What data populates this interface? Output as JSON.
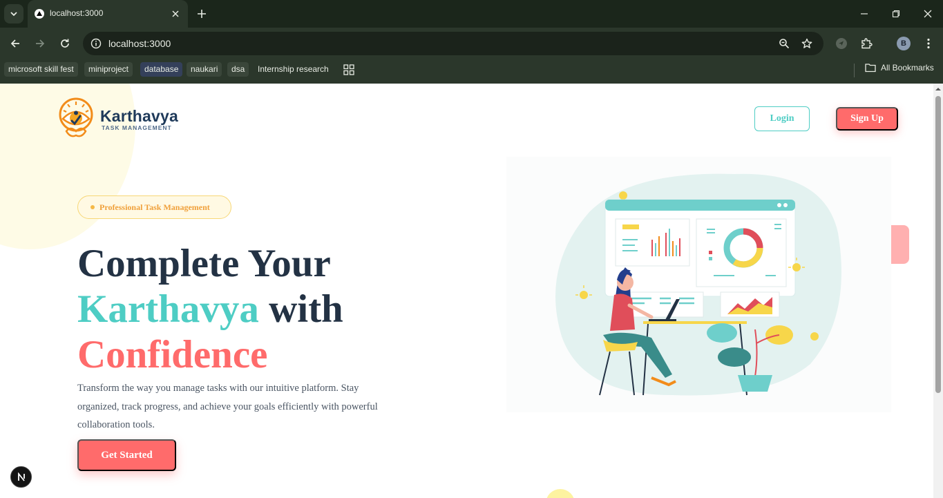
{
  "browser": {
    "tab_title": "localhost:3000",
    "url": "localhost:3000",
    "profile_initial": "B",
    "bookmarks": [
      "microsoft skill fest",
      "miniproject",
      "database",
      "naukari",
      "dsa",
      "Internship research"
    ],
    "all_bookmarks_label": "All Bookmarks"
  },
  "header": {
    "brand_name": "Karthavya",
    "brand_tagline": "TASK MANAGEMENT",
    "login_label": "Login",
    "signup_label": "Sign Up"
  },
  "hero": {
    "badge": "Professional Task Management",
    "headline_line1": "Complete Your",
    "headline_teal": "Karthavya",
    "headline_with": "with",
    "headline_coral": "Confidence",
    "description": "Transform the way you manage tasks with our intuitive platform. Stay organized, track progress, and achieve your goals efficiently with powerful collaboration tools.",
    "cta_label": "Get Started"
  },
  "colors": {
    "teal": "#4ecdc4",
    "coral": "#ff6b6b",
    "navy": "#233244",
    "amber": "#f0a03a"
  }
}
